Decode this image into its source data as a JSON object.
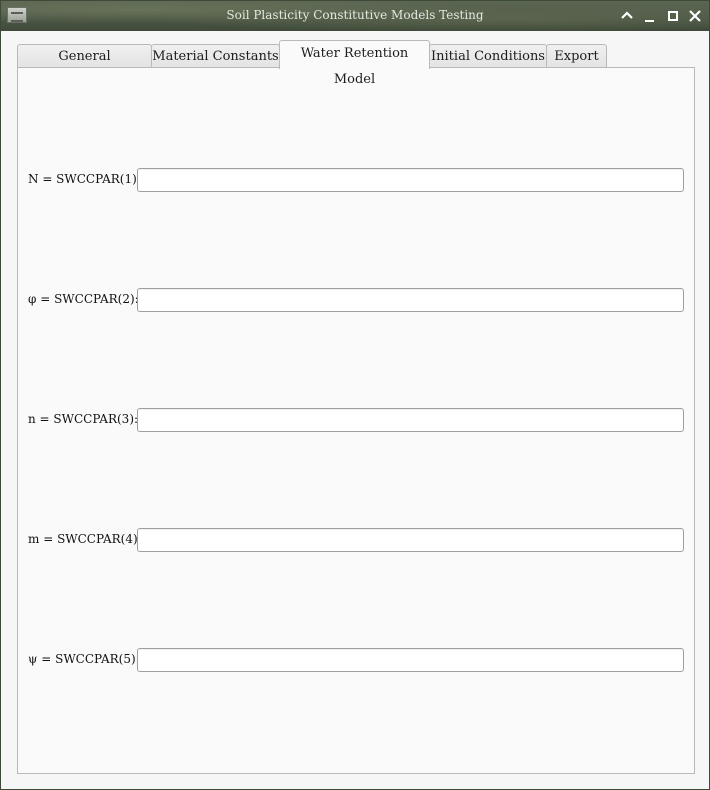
{
  "window": {
    "title": "Soil Plasticity Constitutive Models Testing"
  },
  "tabs": [
    {
      "label": "General Information",
      "active": false
    },
    {
      "label": "Material Constants",
      "active": false
    },
    {
      "label": "Water Retention Model",
      "active": true
    },
    {
      "label": "Initial Conditions",
      "active": false
    },
    {
      "label": "Export",
      "active": false
    }
  ],
  "fields": [
    {
      "label": "N = SWCCPAR(1):",
      "value": ""
    },
    {
      "label": "φ = SWCCPAR(2):",
      "value": ""
    },
    {
      "label": "n = SWCCPAR(3):",
      "value": ""
    },
    {
      "label": "m = SWCCPAR(4):",
      "value": ""
    },
    {
      "label": "ψ = SWCCPAR(5):",
      "value": ""
    }
  ],
  "icons": {
    "app": "app-icon",
    "collapse": "chevron-up-icon",
    "minimize": "minimize-icon",
    "maximize": "maximize-icon",
    "close": "close-icon"
  }
}
